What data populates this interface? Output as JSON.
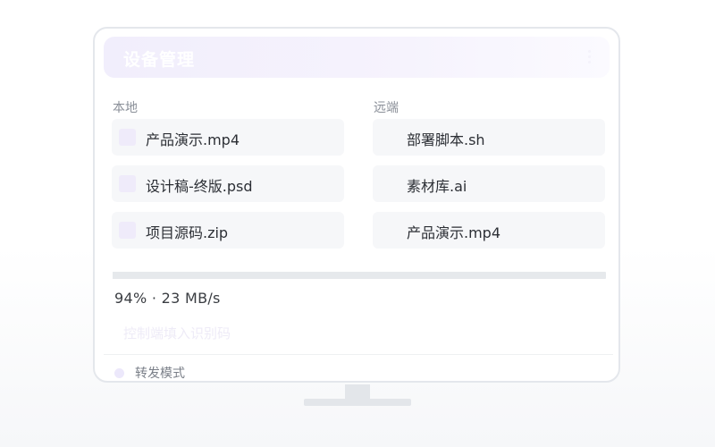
{
  "header": {
    "title": "设备管理"
  },
  "local": {
    "label": "本地",
    "files": [
      {
        "name": "产品演示.mp4"
      },
      {
        "name": "设计稿-终版.psd"
      },
      {
        "name": "项目源码.zip"
      }
    ]
  },
  "remote": {
    "label": "远端",
    "files": [
      {
        "name": "部署脚本.sh"
      },
      {
        "name": "素材库.ai"
      },
      {
        "name": "产品演示.mp4"
      }
    ]
  },
  "transfer": {
    "progress": 0.94,
    "status_text": "94% · 23 MB/s"
  },
  "code_input": {
    "placeholder": "控制端填入识别码",
    "value": ""
  },
  "relay_mode": {
    "label": "转发模式"
  },
  "colors": {
    "accent_light": "#efebfa",
    "item_bg": "#f6f7f9",
    "track": "#e6e9ec",
    "frame": "#e4e7ec"
  }
}
